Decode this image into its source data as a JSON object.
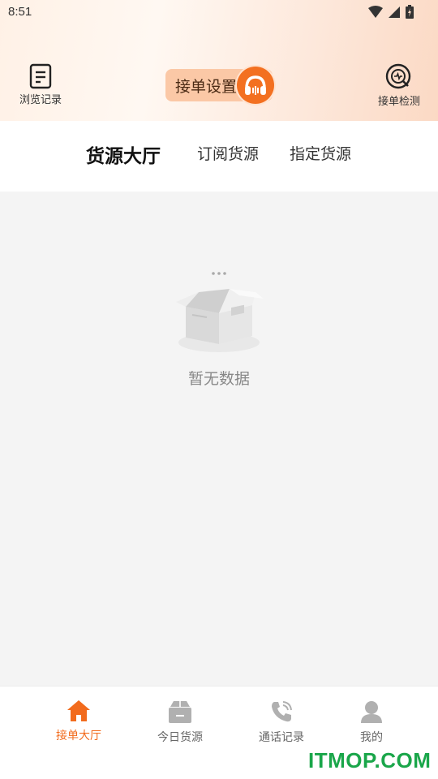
{
  "status_bar": {
    "time": "8:51"
  },
  "header": {
    "browse_label": "浏览记录",
    "order_settings_label": "接单设置",
    "order_check_label": "接单检测"
  },
  "tabs": [
    {
      "label": "货源大厅",
      "active": true
    },
    {
      "label": "订阅货源",
      "active": false
    },
    {
      "label": "指定货源",
      "active": false
    }
  ],
  "empty_state": {
    "text": "暂无数据"
  },
  "bottom_nav": [
    {
      "label": "接单大厅",
      "icon": "home-icon",
      "active": true
    },
    {
      "label": "今日货源",
      "icon": "box-icon",
      "active": false
    },
    {
      "label": "通话记录",
      "icon": "phone-icon",
      "active": false
    },
    {
      "label": "我的",
      "icon": "person-icon",
      "active": false
    }
  ],
  "watermark": "ITMOP.COM",
  "colors": {
    "accent": "#f26b1d",
    "pill": "#fbc8a6"
  }
}
